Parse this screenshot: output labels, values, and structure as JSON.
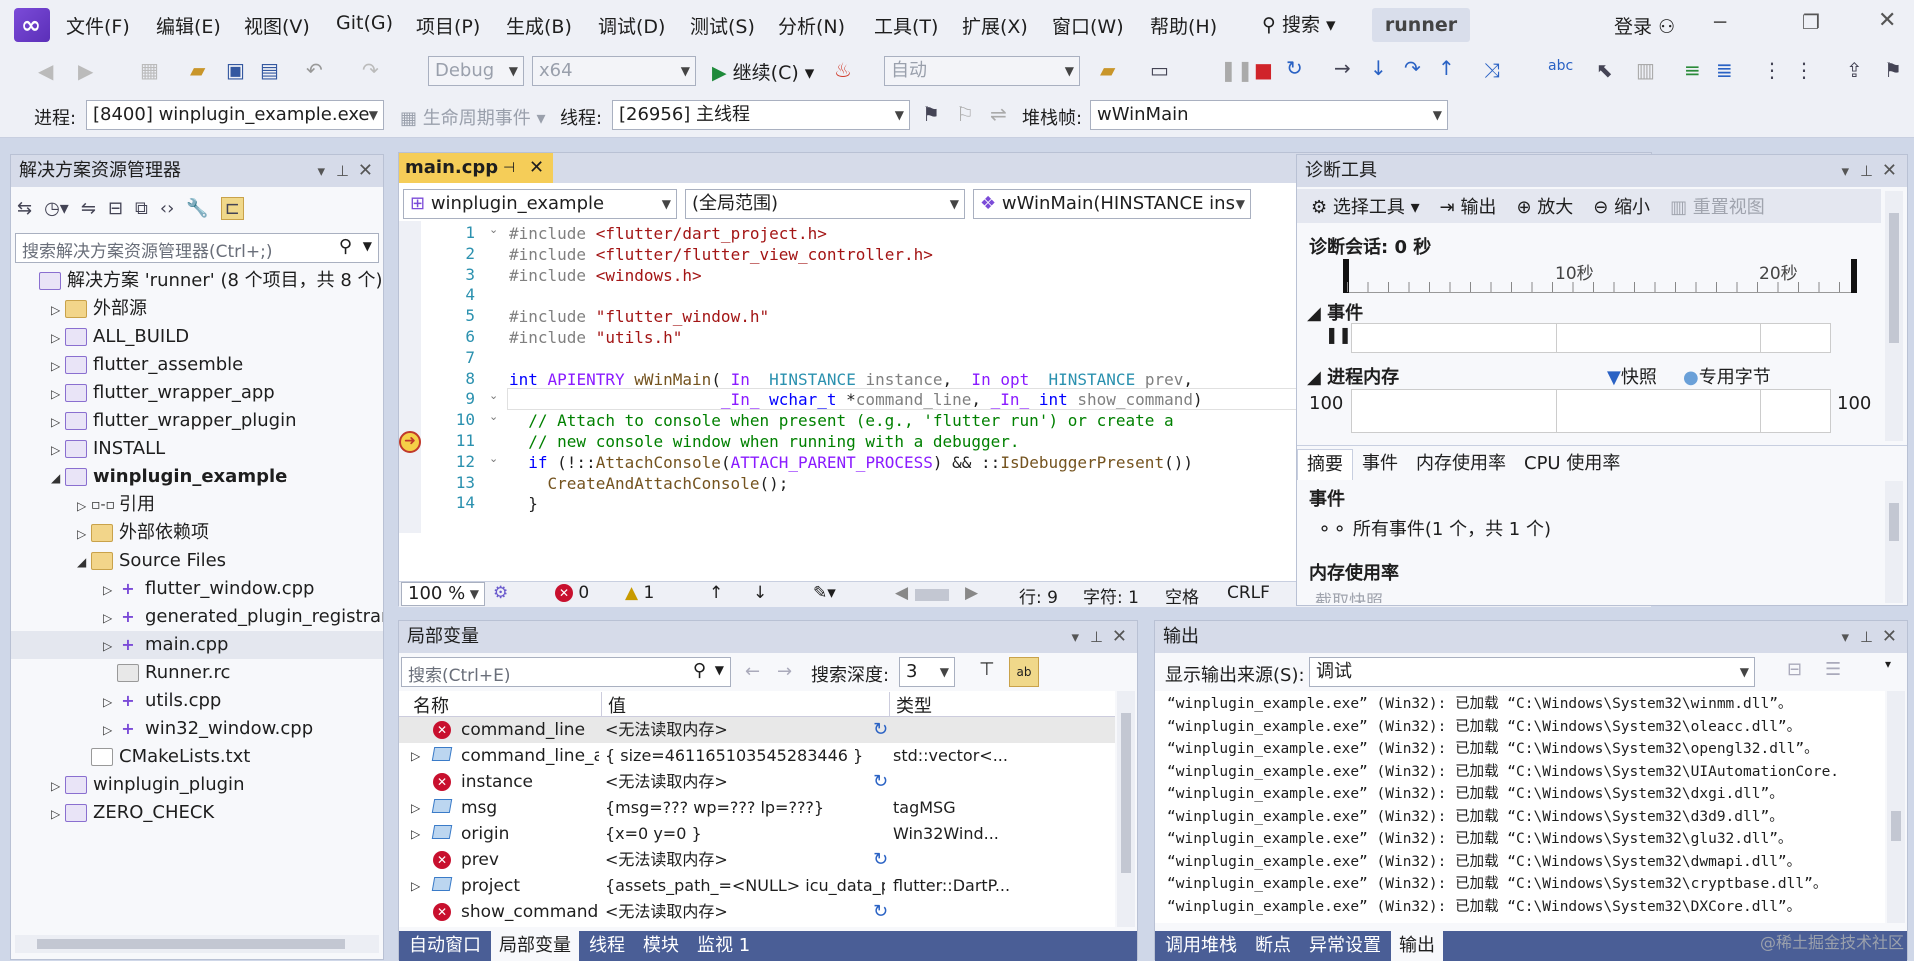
{
  "menu": [
    "文件(F)",
    "编辑(E)",
    "视图(V)",
    "Git(G)",
    "项目(P)",
    "生成(B)",
    "调试(D)",
    "测试(S)",
    "分析(N)",
    "工具(T)",
    "扩展(X)",
    "窗口(W)",
    "帮助(H)"
  ],
  "search_label": "搜索",
  "solution_name": "runner",
  "login_label": "登录",
  "toolbar": {
    "config": "Debug",
    "platform": "x64",
    "continue_label": "继续(C)",
    "auto_label": "自动",
    "process_label": "进程:",
    "process_value": "[8400] winplugin_example.exe",
    "lifecycle_label": "生命周期事件",
    "thread_label": "线程:",
    "thread_value": "[26956] 主线程",
    "stackframe_label": "堆栈帧:",
    "stackframe_value": "wWinMain"
  },
  "solution_explorer": {
    "title": "解决方案资源管理器",
    "search_placeholder": "搜索解决方案资源管理器(Ctrl+;)",
    "nodes": [
      {
        "label": "解决方案 'runner' (8 个项目，共 8 个)",
        "exp": "",
        "icon": "sol",
        "indent": 0,
        "bold": false
      },
      {
        "label": "外部源",
        "exp": "▷",
        "icon": "ext",
        "indent": 1,
        "bold": false
      },
      {
        "label": "ALL_BUILD",
        "exp": "▷",
        "icon": "proj",
        "indent": 1,
        "bold": false
      },
      {
        "label": "flutter_assemble",
        "exp": "▷",
        "icon": "proj",
        "indent": 1,
        "bold": false
      },
      {
        "label": "flutter_wrapper_app",
        "exp": "▷",
        "icon": "proj",
        "indent": 1,
        "bold": false
      },
      {
        "label": "flutter_wrapper_plugin",
        "exp": "▷",
        "icon": "proj",
        "indent": 1,
        "bold": false
      },
      {
        "label": "INSTALL",
        "exp": "▷",
        "icon": "proj",
        "indent": 1,
        "bold": false
      },
      {
        "label": "winplugin_example",
        "exp": "◢",
        "icon": "proj",
        "indent": 1,
        "bold": true
      },
      {
        "label": "引用",
        "exp": "▷",
        "icon": "ref",
        "indent": 2,
        "bold": false
      },
      {
        "label": "外部依赖项",
        "exp": "▷",
        "icon": "folder",
        "indent": 2,
        "bold": false
      },
      {
        "label": "Source Files",
        "exp": "◢",
        "icon": "folder",
        "indent": 2,
        "bold": false
      },
      {
        "label": "flutter_window.cpp",
        "exp": "▷",
        "icon": "cpp",
        "indent": 3,
        "bold": false
      },
      {
        "label": "generated_plugin_registran",
        "exp": "▷",
        "icon": "cpp",
        "indent": 3,
        "bold": false
      },
      {
        "label": "main.cpp",
        "exp": "▷",
        "icon": "cpp",
        "indent": 3,
        "bold": false
      },
      {
        "label": "Runner.rc",
        "exp": "",
        "icon": "rc",
        "indent": 3,
        "bold": false
      },
      {
        "label": "utils.cpp",
        "exp": "▷",
        "icon": "cpp",
        "indent": 3,
        "bold": false
      },
      {
        "label": "win32_window.cpp",
        "exp": "▷",
        "icon": "cpp",
        "indent": 3,
        "bold": false
      },
      {
        "label": "CMakeLists.txt",
        "exp": "",
        "icon": "txt",
        "indent": 2,
        "bold": false
      },
      {
        "label": "winplugin_plugin",
        "exp": "▷",
        "icon": "proj",
        "indent": 1,
        "bold": false
      },
      {
        "label": "ZERO_CHECK",
        "exp": "▷",
        "icon": "proj",
        "indent": 1,
        "bold": false
      }
    ]
  },
  "editor": {
    "tab": "main.cpp",
    "project_combo": "winplugin_example",
    "scope_combo": "(全局范围)",
    "function_combo": "wWinMain(HINSTANCE ins",
    "zoom": "100 %",
    "errors": "0",
    "warnings": "1",
    "line_info": "行: 9",
    "char_info": "字符: 1",
    "space_info": "空格",
    "eol_info": "CRLF",
    "lines": [
      {
        "n": "1",
        "html": "<span class='pp'>#include </span><span class='str'>&lt;flutter/dart_project.h&gt;</span>"
      },
      {
        "n": "2",
        "html": "<span class='pp'>#include </span><span class='str'>&lt;flutter/flutter_view_controller.h&gt;</span>"
      },
      {
        "n": "3",
        "html": "<span class='pp'>#include </span><span class='str'>&lt;windows.h&gt;</span>"
      },
      {
        "n": "4",
        "html": ""
      },
      {
        "n": "5",
        "html": "<span class='pp'>#include </span><span class='str'>\"flutter_window.h\"</span>"
      },
      {
        "n": "6",
        "html": "<span class='pp'>#include </span><span class='str'>\"utils.h\"</span>"
      },
      {
        "n": "7",
        "html": ""
      },
      {
        "n": "8",
        "html": "<span class='kw'>int</span> <span class='mac'>APIENTRY</span> <span class='fn'>wWinMain</span>(<span class='mac'>_In_</span> <span class='ty'>HINSTANCE</span> <span class='par'>instance</span>, <span class='mac'>_In_opt_</span> <span class='ty'>HINSTANCE</span> <span class='par'>prev</span>,"
      },
      {
        "n": "9",
        "html": "                      <span class='mac'>_In_</span> <span class='kw'>wchar_t</span> *<span class='par'>command_line</span>, <span class='mac'>_In_</span> <span class='kw'>int</span> <span class='par'>show_command</span>)"
      },
      {
        "n": "10",
        "html": "  <span class='cm'>// Attach to console when present (e.g., 'flutter run') or create a</span>"
      },
      {
        "n": "11",
        "html": "  <span class='cm'>// new console window when running with a debugger.</span>"
      },
      {
        "n": "12",
        "html": "  <span class='kw'>if</span> (!::<span class='fn'>AttachConsole</span>(<span class='mac'>ATTACH_PARENT_PROCESS</span>) &amp;&amp; ::<span class='fn'>IsDebuggerPresent</span>())"
      },
      {
        "n": "13",
        "html": "    <span class='fn'>CreateAndAttachConsole</span>();"
      },
      {
        "n": "14",
        "html": "  }"
      }
    ]
  },
  "diagnostics": {
    "title": "诊断工具",
    "select_tool": "选择工具",
    "output_btn": "输出",
    "zoom_in": "放大",
    "zoom_out": "缩小",
    "reset_view": "重置视图",
    "session": "诊断会话: 0 秒",
    "tick_10": "10秒",
    "tick_20": "20秒",
    "events_header": "事件",
    "memory_header": "进程内存",
    "snapshot_legend": "快照",
    "private_bytes_legend": "专用字节",
    "mem_left": "100",
    "mem_right": "100",
    "tabs": [
      "摘要",
      "事件",
      "内存使用率",
      "CPU 使用率"
    ],
    "events_section": "事件",
    "all_events": "所有事件(1 个，共 1 个)",
    "memory_section": "内存使用率",
    "snapshot_btn": "截取快照"
  },
  "locals": {
    "title": "局部变量",
    "search_placeholder": "搜索(Ctrl+E)",
    "depth_label": "搜索深度:",
    "depth_value": "3",
    "col_name": "名称",
    "col_value": "值",
    "col_type": "类型",
    "rows": [
      {
        "name": "command_line",
        "value": "<无法读取内存>",
        "type": "",
        "icon": "err",
        "exp": "",
        "refresh": true
      },
      {
        "name": "command_line_argu...",
        "value": "{ size=461165103545283446 }",
        "type": "std::vector<...",
        "icon": "obj",
        "exp": "▷",
        "refresh": false
      },
      {
        "name": "instance",
        "value": "<无法读取内存>",
        "type": "",
        "icon": "err",
        "exp": "",
        "refresh": true
      },
      {
        "name": "msg",
        "value": "{msg=??? wp=??? lp=???}",
        "type": "tagMSG",
        "icon": "obj",
        "exp": "▷",
        "refresh": false
      },
      {
        "name": "origin",
        "value": "{x=0 y=0 }",
        "type": "Win32Wind...",
        "icon": "obj",
        "exp": "▷",
        "refresh": false
      },
      {
        "name": "prev",
        "value": "<无法读取内存>",
        "type": "",
        "icon": "err",
        "exp": "",
        "refresh": true
      },
      {
        "name": "project",
        "value": "{assets_path_=<NULL> icu_data_path_=<N...",
        "type": "flutter::DartP...",
        "icon": "obj",
        "exp": "▷",
        "refresh": false
      },
      {
        "name": "show_command",
        "value": "<无法读取内存>",
        "type": "",
        "icon": "err",
        "exp": "",
        "refresh": true
      }
    ],
    "bottom_tabs": [
      "自动窗口",
      "局部变量",
      "线程",
      "模块",
      "监视 1"
    ]
  },
  "output": {
    "title": "输出",
    "source_label": "显示输出来源(S):",
    "source_value": "调试",
    "lines": [
      "“winplugin_example.exe” (Win32): 已加载 “C:\\Windows\\System32\\winmm.dll”。",
      "“winplugin_example.exe” (Win32): 已加载 “C:\\Windows\\System32\\oleacc.dll”。",
      "“winplugin_example.exe” (Win32): 已加载 “C:\\Windows\\System32\\opengl32.dll”。",
      "“winplugin_example.exe” (Win32): 已加载 “C:\\Windows\\System32\\UIAutomationCore.",
      "“winplugin_example.exe” (Win32): 已加载 “C:\\Windows\\System32\\dxgi.dll”。",
      "“winplugin_example.exe” (Win32): 已加载 “C:\\Windows\\System32\\d3d9.dll”。",
      "“winplugin_example.exe” (Win32): 已加载 “C:\\Windows\\System32\\glu32.dll”。",
      "“winplugin_example.exe” (Win32): 已加载 “C:\\Windows\\System32\\dwmapi.dll”。",
      "“winplugin_example.exe” (Win32): 已加载 “C:\\Windows\\System32\\cryptbase.dll”。",
      "“winplugin_example.exe” (Win32): 已加载 “C:\\Windows\\System32\\DXCore.dll”。"
    ],
    "bottom_tabs": [
      "调用堆栈",
      "断点",
      "异常设置",
      "输出"
    ]
  },
  "watermark": "@稀土掘金技术社区"
}
